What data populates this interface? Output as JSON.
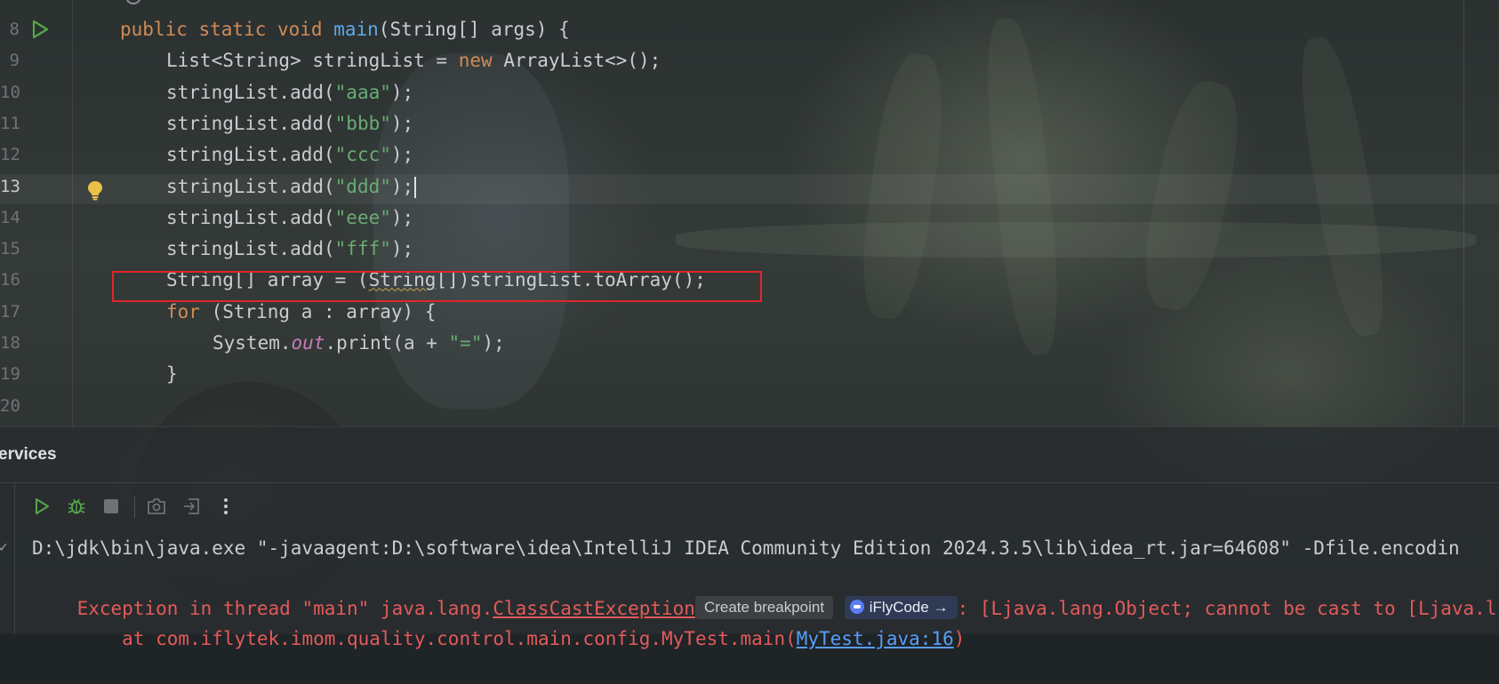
{
  "editor": {
    "lines": [
      {
        "num": "8",
        "code_html": "<span class=\"kw\">public static void </span><span class=\"fn\">main</span>(String[] args) {"
      },
      {
        "num": "9",
        "code_html": "List&lt;String&gt; stringList = <span class=\"kw\">new </span>ArrayList&lt;&gt;();"
      },
      {
        "num": "10",
        "code_html": "stringList.add(<span class=\"str\">\"aaa\"</span>);"
      },
      {
        "num": "11",
        "code_html": "stringList.add(<span class=\"str\">\"bbb\"</span>);"
      },
      {
        "num": "12",
        "code_html": "stringList.add(<span class=\"str\">\"ccc\"</span>);"
      },
      {
        "num": "13",
        "code_html": "stringList.add(<span class=\"str\">\"ddd\"</span>);<span class=\"caret\"></span>"
      },
      {
        "num": "14",
        "code_html": "stringList.add(<span class=\"str\">\"eee\"</span>);"
      },
      {
        "num": "15",
        "code_html": "stringList.add(<span class=\"str\">\"fff\"</span>);"
      },
      {
        "num": "16",
        "code_html": "String[] array = (<span class=\"squig\">String</span>[])stringList.toArray();"
      },
      {
        "num": "17",
        "code_html": "<span class=\"kw\">for </span>(String a : array) {"
      },
      {
        "num": "18",
        "code_html": "System.<span class=\"fld\">out</span>.print(a + <span class=\"str\">\"=\"</span>);"
      },
      {
        "num": "19",
        "code_html": "}"
      },
      {
        "num": "20",
        "code_html": ""
      }
    ],
    "current_line": "13"
  },
  "tool_window": {
    "title": "ervices",
    "icons": [
      "run-icon",
      "debug-icon",
      "stop-icon",
      "camera-icon",
      "exit-icon",
      "more-icon"
    ]
  },
  "console": {
    "cmd_line": "D:\\jdk\\bin\\java.exe \"-javaagent:D:\\software\\idea\\IntelliJ IDEA Community Edition 2024.3.5\\lib\\idea_rt.jar=64608\" -Dfile.encodin",
    "exception_prefix": "Exception in thread \"main\" java.lang.",
    "exception_class": "ClassCastException",
    "chip_breakpoint": "Create breakpoint",
    "chip_ifly": "iFlyCode",
    "chip_ifly_arrow": "→",
    "exception_message": ": [Ljava.lang.Object; cannot be cast to [Ljava.l",
    "stack_prefix": "    at com.iflytek.imom.quality.control.main.config.MyTest.main(",
    "stack_link": "MyTest.java:16",
    "stack_suffix": ")"
  },
  "colors": {
    "keyword": "#d08b57",
    "function": "#5fa7ea",
    "string": "#6aab73",
    "error": "#e35a5a",
    "highlight_box": "#e0262b"
  }
}
